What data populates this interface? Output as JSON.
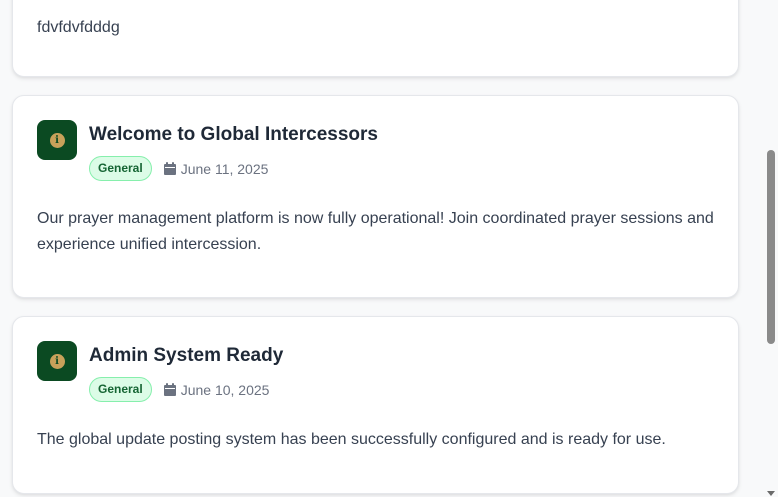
{
  "feed": {
    "cards": [
      {
        "body": "fdvfdvfdddg"
      },
      {
        "title": "Welcome to Global Intercessors",
        "badge": "General",
        "date": "June 11, 2025",
        "body": "Our prayer management platform is now fully operational! Join coordinated prayer sessions and experience unified intercession."
      },
      {
        "title": "Admin System Ready",
        "badge": "General",
        "date": "June 10, 2025",
        "body": "The global update posting system has been successfully configured and is ready for use."
      }
    ]
  },
  "icons": {
    "card_icon": "info-icon",
    "date_icon": "calendar-icon",
    "info_glyph": "i"
  },
  "colors": {
    "icon_bg": "#0b4a22",
    "icon_accent": "#c8a15a",
    "badge_bg": "#dcfce7",
    "badge_text": "#166534"
  },
  "scroll": {
    "position_fraction": 0.4
  }
}
